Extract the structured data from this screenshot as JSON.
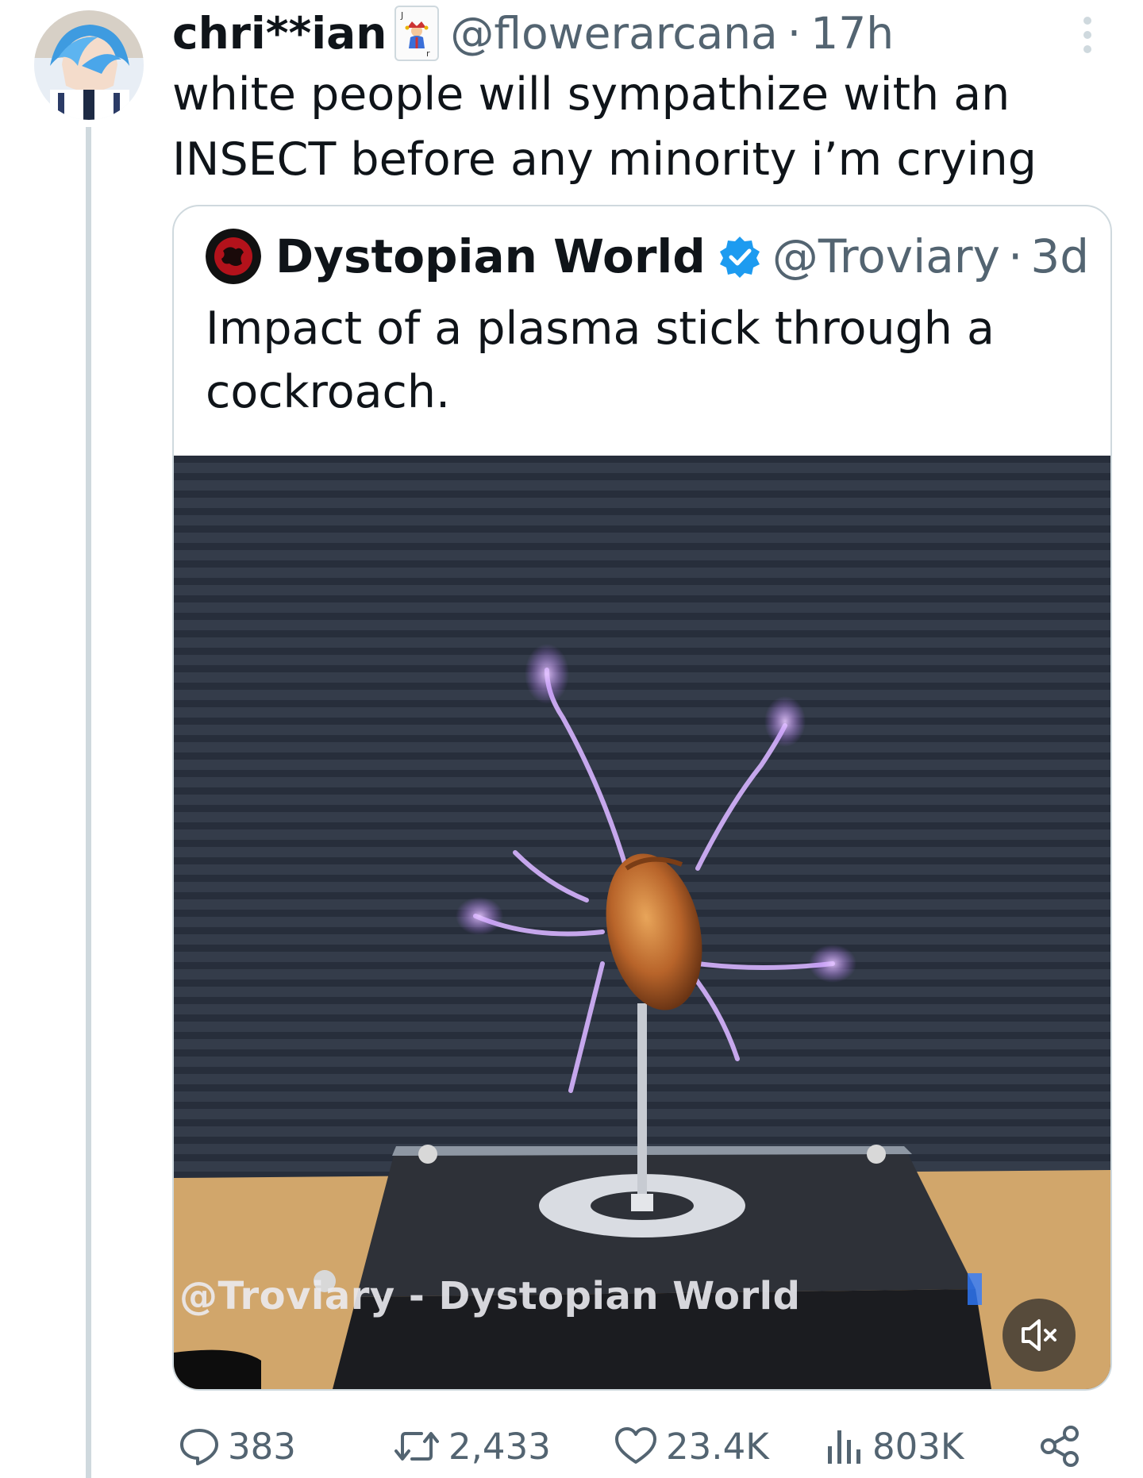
{
  "tweet": {
    "display_name": "chri**ian",
    "handle": "@flowerarcana",
    "separator": "·",
    "time": "17h",
    "text": "white people will sympathize with an INSECT before any minority i’m crying",
    "more_icon": "more-vertical-icon"
  },
  "quoted_tweet": {
    "display_name": "Dystopian World",
    "handle": "@Troviary",
    "separator": "·",
    "time": "3d",
    "text": "Impact of a plasma stick through a cockroach.",
    "verified_color": "#1d9bf0",
    "media": {
      "type": "video",
      "watermark": "@Troviary - Dystopian World",
      "mute_icon": "volume-muted-icon"
    }
  },
  "actions": {
    "replies": "383",
    "reposts": "2,433",
    "likes": "23.4K",
    "views": "803K"
  },
  "colors": {
    "secondary_text": "#536471",
    "thread_line": "#cfd9de",
    "border": "#cfd9de"
  }
}
